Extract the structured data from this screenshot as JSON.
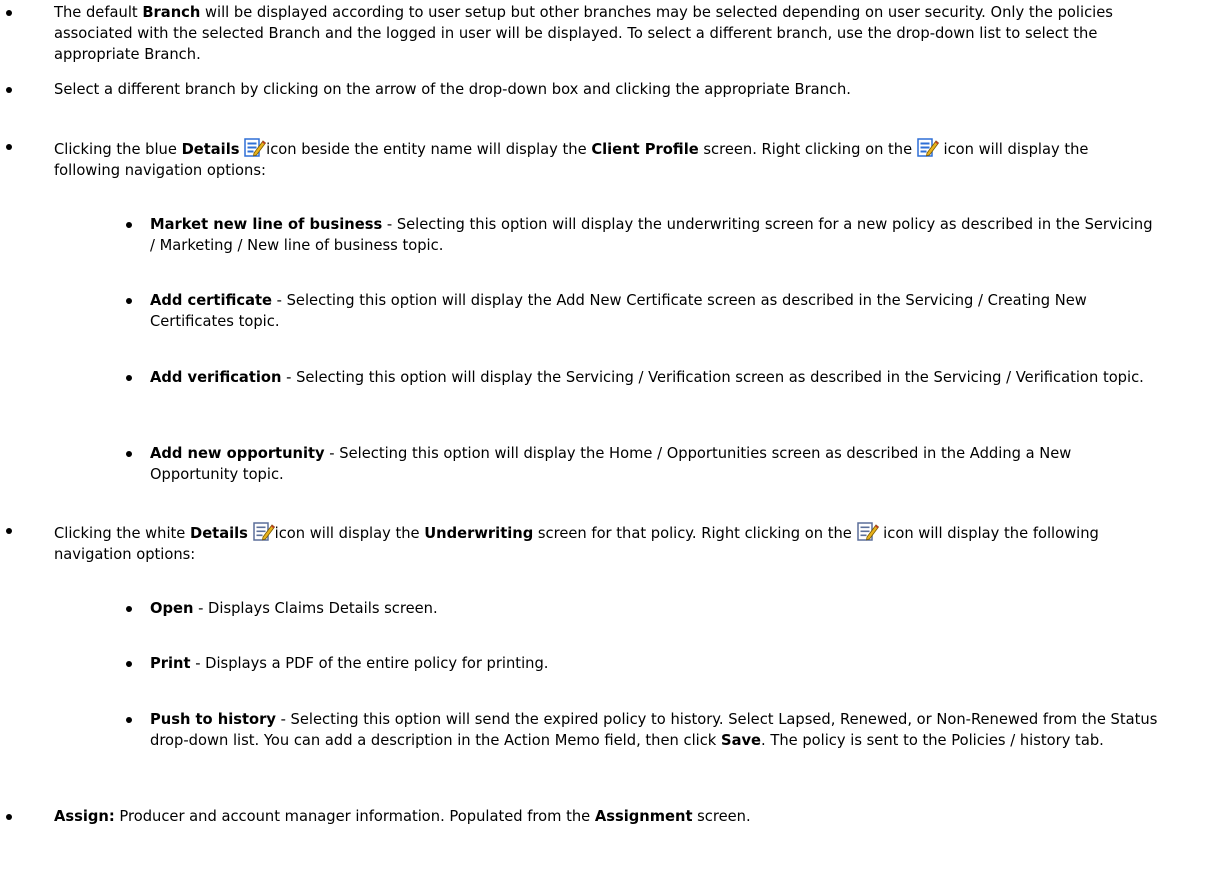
{
  "items": [
    {
      "t0": "The default ",
      "b1": "Branch",
      "t2": " will be displayed according to user setup but other branches may be selected depending on user security. Only the policies associated with the selected Branch and the logged in user will be displayed. To select a different branch, use the drop-down list to select the appropriate Branch."
    },
    {
      "t0": "Select a different branch by clicking on the arrow of the drop-down box and clicking the appropriate Branch."
    },
    {
      "t0": "Clicking the blue ",
      "b1": "Details",
      "t2": "icon beside the entity name will display the ",
      "b3": "Client Profile",
      "t4": " screen. Right clicking on the ",
      "t5": " icon will display the following navigation options:"
    },
    {
      "b0": "Market new line of business",
      "t1": " - Selecting this option will display the underwriting screen for a new policy as described in the Servicing / Marketing / New line of business topic."
    },
    {
      "b0": "Add certificate",
      "t1": " - Selecting this option will display the Add New Certificate screen as described in the Servicing / Creating New Certificates topic."
    },
    {
      "b0": "Add verification",
      "t1": " - Selecting this option will display the Servicing / Verification screen as described in the Servicing / Verification topic."
    },
    {
      "b0": "Add new opportunity",
      "t1": " - Selecting this option will display the Home / Opportunities screen as described in the Adding a New Opportunity topic."
    },
    {
      "t0": "Clicking the white ",
      "b1": "Details",
      "t2": "icon will display the ",
      "b3": "Underwriting",
      "t4": " screen for that policy. Right clicking on the ",
      "t5": " icon will display the following navigation options:"
    },
    {
      "b0": "Open",
      "t1": " - Displays Claims Details screen."
    },
    {
      "b0": "Print",
      "t1": " - Displays a PDF of the entire policy for printing."
    },
    {
      "b0": "Push to history",
      "t1": " - Selecting this option will send the expired policy to history. Select Lapsed, Renewed, or Non-Renewed from the Status drop-down list. You can add a description in the Action Memo field, then click ",
      "b2": "Save",
      "t3": ". The policy is sent to the Policies / history tab."
    },
    {
      "b0": "Assign:",
      "t1": " Producer and account manager information. Populated from the ",
      "b2": "Assignment",
      "t3": " screen."
    }
  ],
  "icons": {
    "blue_details": "details-edit-icon-blue",
    "white_details": "details-edit-icon-white"
  },
  "colors": {
    "text": "#000000",
    "icon_blue": "#2e6fd6",
    "icon_pencil": "#e8b21c"
  }
}
